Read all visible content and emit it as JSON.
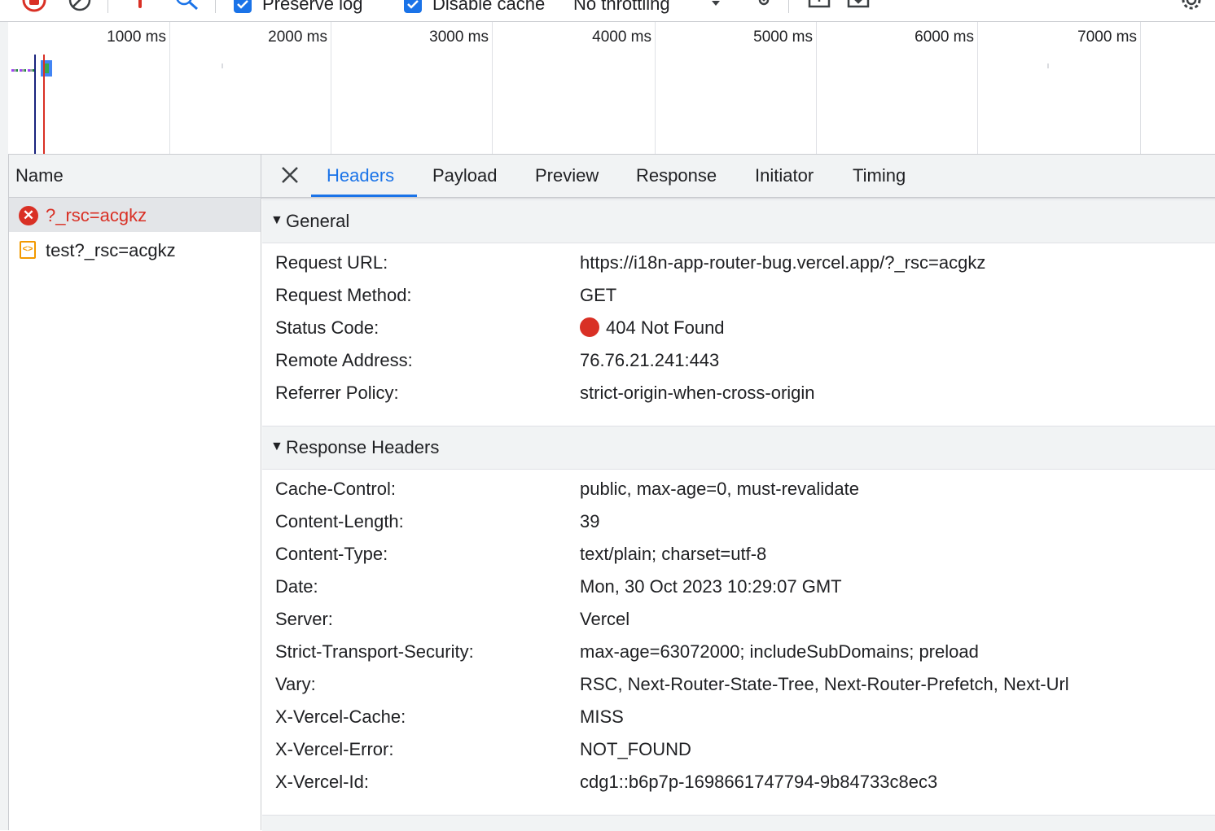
{
  "toolbar": {
    "preserve_log": "Preserve log",
    "disable_cache": "Disable cache",
    "throttling": "No throttling"
  },
  "timeline": {
    "ticks": [
      "1000 ms",
      "2000 ms",
      "3000 ms",
      "4000 ms",
      "5000 ms",
      "6000 ms",
      "7000 ms"
    ]
  },
  "requests": {
    "column_header": "Name",
    "items": [
      {
        "name": "?_rsc=acgkz",
        "status": "error",
        "selected": true
      },
      {
        "name": "test?_rsc=acgkz",
        "status": "document",
        "selected": false
      }
    ]
  },
  "tabs": [
    "Headers",
    "Payload",
    "Preview",
    "Response",
    "Initiator",
    "Timing"
  ],
  "active_tab": "Headers",
  "general": {
    "title": "General",
    "rows": [
      {
        "key": "Request URL:",
        "value": "https://i18n-app-router-bug.vercel.app/?_rsc=acgkz"
      },
      {
        "key": "Request Method:",
        "value": "GET"
      },
      {
        "key": "Status Code:",
        "value": "404 Not Found"
      },
      {
        "key": "Remote Address:",
        "value": "76.76.21.241:443"
      },
      {
        "key": "Referrer Policy:",
        "value": "strict-origin-when-cross-origin"
      }
    ]
  },
  "response_headers": {
    "title": "Response Headers",
    "rows": [
      {
        "key": "Cache-Control:",
        "value": "public, max-age=0, must-revalidate"
      },
      {
        "key": "Content-Length:",
        "value": "39"
      },
      {
        "key": "Content-Type:",
        "value": "text/plain; charset=utf-8"
      },
      {
        "key": "Date:",
        "value": "Mon, 30 Oct 2023 10:29:07 GMT"
      },
      {
        "key": "Server:",
        "value": "Vercel"
      },
      {
        "key": "Strict-Transport-Security:",
        "value": "max-age=63072000; includeSubDomains; preload"
      },
      {
        "key": "Vary:",
        "value": "RSC, Next-Router-State-Tree, Next-Router-Prefetch, Next-Url"
      },
      {
        "key": "X-Vercel-Cache:",
        "value": "MISS"
      },
      {
        "key": "X-Vercel-Error:",
        "value": "NOT_FOUND"
      },
      {
        "key": "X-Vercel-Id:",
        "value": "cdg1::b6p7p-1698661747794-9b84733c8ec3"
      }
    ]
  },
  "colors": {
    "accent": "#1a73e8",
    "error": "#d93025",
    "document": "#f29900"
  }
}
